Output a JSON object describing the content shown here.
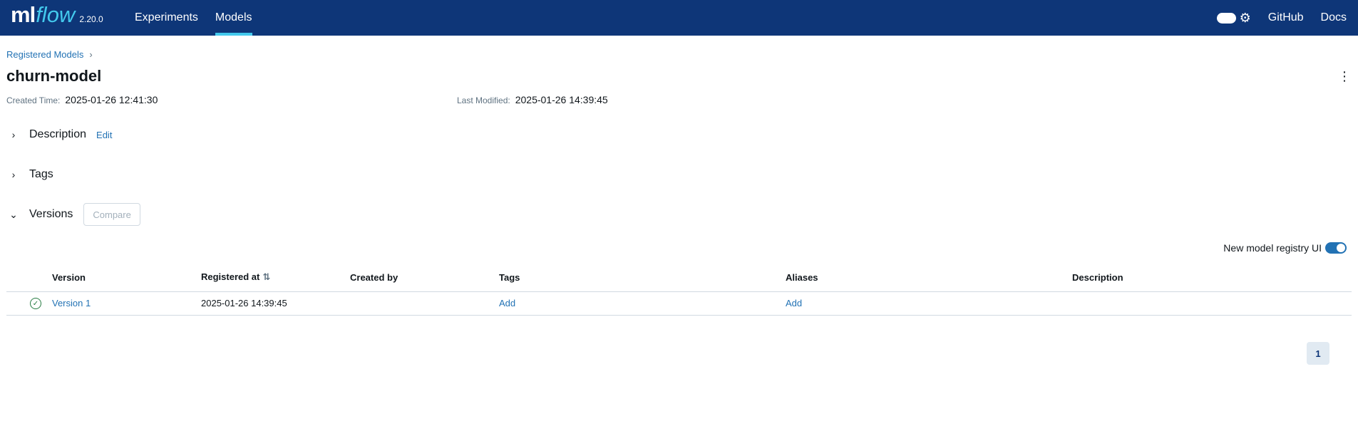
{
  "header": {
    "brand_ml": "ml",
    "brand_flow": "flow",
    "version": "2.20.0",
    "nav": [
      {
        "label": "Experiments",
        "active": false
      },
      {
        "label": "Models",
        "active": true
      }
    ],
    "links": [
      "GitHub",
      "Docs"
    ],
    "icons": {
      "theme_toggle": "toggle-icon",
      "settings": "gear-icon"
    },
    "colors": {
      "background": "#0e3678",
      "accent": "#43c9ed"
    }
  },
  "breadcrumb": {
    "root": "Registered Models",
    "separator": "›"
  },
  "page": {
    "title": "churn-model",
    "created_label": "Created Time:",
    "created_value": "2025-01-26 12:41:30",
    "modified_label": "Last Modified:",
    "modified_value": "2025-01-26 14:39:45"
  },
  "sections": {
    "description": {
      "label": "Description",
      "edit": "Edit",
      "expanded": false
    },
    "tags": {
      "label": "Tags",
      "expanded": false
    },
    "versions": {
      "label": "Versions",
      "compare": "Compare",
      "expanded": true
    }
  },
  "registry_toggle": {
    "label": "New model registry UI",
    "on": true
  },
  "table": {
    "headers": [
      "Version",
      "Registered at",
      "Created by",
      "Tags",
      "Aliases",
      "Description"
    ],
    "rows": [
      {
        "status": "ready",
        "version": "Version 1",
        "registered_at": "2025-01-26 14:39:45",
        "created_by": "",
        "tags": "Add",
        "aliases": "Add",
        "description": ""
      }
    ]
  },
  "pagination": {
    "current": "1"
  }
}
